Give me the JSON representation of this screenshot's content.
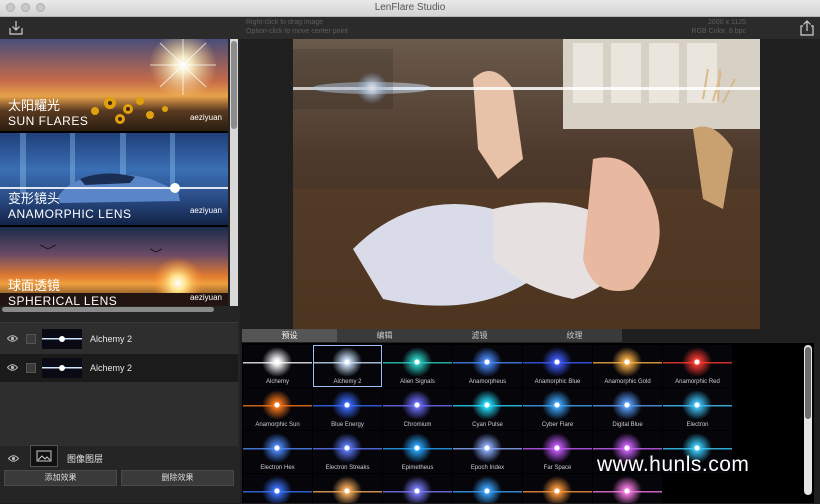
{
  "window": {
    "title": "LenFlare Studio"
  },
  "toolbar": {
    "hint_line1": "Right-click to drag image",
    "hint_line2": "Option-click to move center point",
    "image_size": "2000 x 1125",
    "image_mode": "RGB Color, 8 bpc",
    "import_icon": "import-icon",
    "export_icon": "share-icon"
  },
  "presets": [
    {
      "cn": "太阳耀光",
      "en": "SUN FLARES",
      "logo": "aeziyuan"
    },
    {
      "cn": "变形镜头",
      "en": "ANAMORPHIC LENS",
      "logo": "aeziyuan"
    },
    {
      "cn": "球面透镜",
      "en": "SPHERICAL LENS",
      "logo": "aeziyuan"
    }
  ],
  "layers": [
    {
      "name": "Alchemy 2"
    },
    {
      "name": "Alchemy 2"
    }
  ],
  "image_layer": {
    "label": "图像图层",
    "add_button": "添加效果",
    "delete_button": "删除效果"
  },
  "tabs": [
    "预设",
    "编辑",
    "滤镜",
    "纹理"
  ],
  "active_tab": 0,
  "flares": [
    {
      "name": "Alchemy",
      "color": "#ffffff",
      "selected": false
    },
    {
      "name": "Alchemy 2",
      "color": "#cfe6ff",
      "selected": true
    },
    {
      "name": "Alien Signals",
      "color": "#2bd4c8",
      "selected": false
    },
    {
      "name": "Anamorpheus",
      "color": "#4a8bff",
      "selected": false
    },
    {
      "name": "Anamorphic Blue",
      "color": "#3f5cff",
      "selected": false
    },
    {
      "name": "Anamorphic Gold",
      "color": "#ffb347",
      "selected": false
    },
    {
      "name": "Anamorphic Red",
      "color": "#ff3b30",
      "selected": false
    },
    {
      "name": "Anamorphic Sun",
      "color": "#ff7a1a",
      "selected": false
    },
    {
      "name": "Blue Energy",
      "color": "#3a6bff",
      "selected": false
    },
    {
      "name": "Chromium",
      "color": "#6f6fff",
      "selected": false
    },
    {
      "name": "Cyan Pulse",
      "color": "#25e0ff",
      "selected": false
    },
    {
      "name": "Cyber Flare",
      "color": "#3fa9ff",
      "selected": false
    },
    {
      "name": "Digital Blue",
      "color": "#5aa0ff",
      "selected": false
    },
    {
      "name": "Electron",
      "color": "#40c8ff",
      "selected": false
    },
    {
      "name": "Electron Hex",
      "color": "#4f8dff",
      "selected": false
    },
    {
      "name": "Electron Streaks",
      "color": "#5f7cff",
      "selected": false
    },
    {
      "name": "Epimetheus",
      "color": "#2aa8ff",
      "selected": false
    },
    {
      "name": "Epoch Index",
      "color": "#8fb0ff",
      "selected": false
    },
    {
      "name": "Far Space",
      "color": "#c85cff",
      "selected": false
    },
    {
      "name": "",
      "color": "#d063ff",
      "selected": false
    },
    {
      "name": "",
      "color": "#39d0ff",
      "selected": false
    },
    {
      "name": "",
      "color": "#3b74ff",
      "selected": false
    },
    {
      "name": "",
      "color": "#ffb15e",
      "selected": false
    },
    {
      "name": "",
      "color": "#7d7dff",
      "selected": false
    },
    {
      "name": "",
      "color": "#3aa5ff",
      "selected": false
    },
    {
      "name": "",
      "color": "#ff9a3b",
      "selected": false
    },
    {
      "name": "",
      "color": "#ff7ce8",
      "selected": false
    }
  ],
  "watermark": "www.hunls.com"
}
